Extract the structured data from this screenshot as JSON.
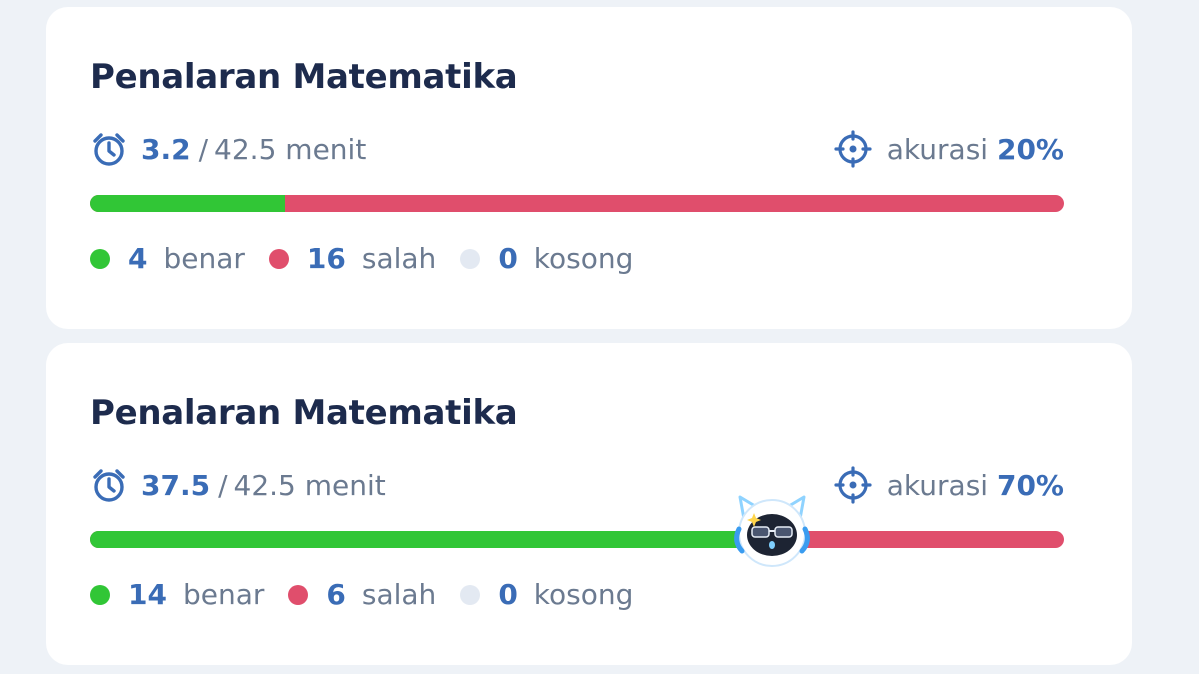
{
  "colors": {
    "correct": "#31c636",
    "wrong": "#e04e6c",
    "empty": "#e3e9f2",
    "accent": "#3a6cb6"
  },
  "cards": [
    {
      "title": "Penalaran Matematika",
      "time_used": "3.2",
      "time_sep": "/",
      "time_total": "42.5 menit",
      "accuracy_label": "akurasi",
      "accuracy_value": "20%",
      "progress_fraction": 0.2,
      "show_mascot": false,
      "icons": {
        "timer": "stopwatch-icon",
        "accuracy": "target-icon"
      },
      "legend": [
        {
          "count": "4",
          "label": "benar",
          "color_key": "correct"
        },
        {
          "count": "16",
          "label": "salah",
          "color_key": "wrong"
        },
        {
          "count": "0",
          "label": "kosong",
          "color_key": "empty"
        }
      ]
    },
    {
      "title": "Penalaran Matematika",
      "time_used": "37.5",
      "time_sep": "/",
      "time_total": "42.5 menit",
      "accuracy_label": "akurasi",
      "accuracy_value": "70%",
      "progress_fraction": 0.7,
      "show_mascot": true,
      "icons": {
        "timer": "stopwatch-icon",
        "accuracy": "target-icon"
      },
      "legend": [
        {
          "count": "14",
          "label": "benar",
          "color_key": "correct"
        },
        {
          "count": "6",
          "label": "salah",
          "color_key": "wrong"
        },
        {
          "count": "0",
          "label": "kosong",
          "color_key": "empty"
        }
      ]
    }
  ]
}
